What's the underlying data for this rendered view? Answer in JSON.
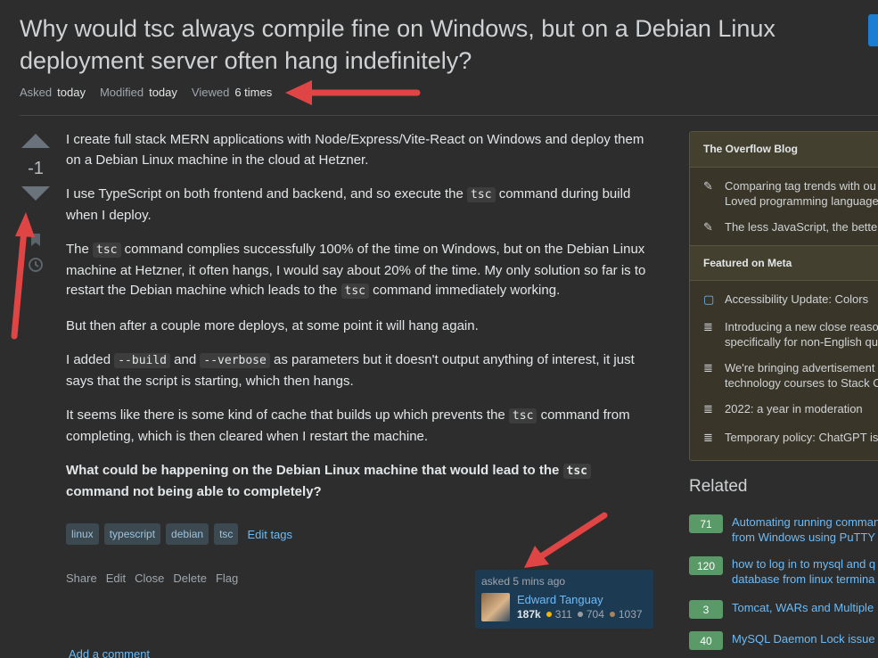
{
  "question": {
    "title": "Why would tsc always compile fine on Windows, but on a Debian Linux deployment server often hang indefinitely?",
    "meta": {
      "asked_label": "Asked",
      "asked_value": "today",
      "modified_label": "Modified",
      "modified_value": "today",
      "viewed_label": "Viewed",
      "viewed_value": "6 times"
    },
    "vote_count": "-1",
    "body": {
      "p1": "I create full stack MERN applications with Node/Express/Vite-React on Windows and deploy them on a Debian Linux machine in the cloud at Hetzner.",
      "p2a": "I use TypeScript on both frontend and backend, and so execute the ",
      "p2code": "tsc",
      "p2b": " command during build when I deploy.",
      "p3a": "The ",
      "p3code1": "tsc",
      "p3b": " command complies successfully 100% of the time on Windows, but on the Debian Linux machine at Hetzner, it often hangs, I would say about 20% of the time. My only solution so far is to restart the Debian machine which leads to the ",
      "p3code2": "tsc",
      "p3c": " command immediately working.",
      "p4": "But then after a couple more deploys, at some point it will hang again.",
      "p5a": "I added ",
      "p5code1": "--build",
      "p5b": " and ",
      "p5code2": "--verbose",
      "p5c": " as parameters but it doesn't output anything of interest, it just says that the script is starting, which then hangs.",
      "p6a": "It seems like there is some kind of cache that builds up which prevents the ",
      "p6code": "tsc",
      "p6b": " command from completing, which is then cleared when I restart the machine.",
      "p7a": "What could be happening on the Debian Linux machine that would lead to the ",
      "p7code": "tsc",
      "p7b": " command not being able to completely?"
    },
    "tags": [
      "linux",
      "typescript",
      "debian",
      "tsc"
    ],
    "edit_tags": "Edit tags",
    "menu": [
      "Share",
      "Edit",
      "Close",
      "Delete",
      "Flag"
    ],
    "add_comment": "Add a comment"
  },
  "user_card": {
    "asked": "asked 5 mins ago",
    "name": "Edward Tanguay",
    "reputation": "187k",
    "gold": "311",
    "silver": "704",
    "bronze": "1037"
  },
  "sidebar": {
    "blog_title": "The Overflow Blog",
    "blog_items": [
      {
        "line1": "Comparing tag trends with ou",
        "line2": "Loved programming language"
      },
      {
        "line1": "The less JavaScript, the better"
      }
    ],
    "meta_title": "Featured on Meta",
    "meta_items": [
      {
        "line1": "Accessibility Update: Colors"
      },
      {
        "line1": "Introducing a new close reaso",
        "line2": "specifically for non-English qu"
      },
      {
        "line1": "We're bringing advertisement",
        "line2": "technology courses to Stack O"
      },
      {
        "line1": "2022: a year in moderation"
      },
      {
        "line1": "Temporary policy: ChatGPT is"
      }
    ]
  },
  "related": {
    "title": "Related",
    "items": [
      {
        "score": "71",
        "line1": "Automating running comman",
        "line2": "from Windows using PuTTY"
      },
      {
        "score": "120",
        "line1": "how to log in to mysql and q",
        "line2": "database from linux termina"
      },
      {
        "score": "3",
        "line1": "Tomcat, WARs and Multiple"
      },
      {
        "score": "40",
        "line1": "MySQL Daemon Lock issue"
      }
    ]
  },
  "colors": {
    "accent_blue": "#6cbbf7",
    "annotation_red": "#e04545",
    "background": "#2d2d2d",
    "score_green": "#5a9a68"
  }
}
